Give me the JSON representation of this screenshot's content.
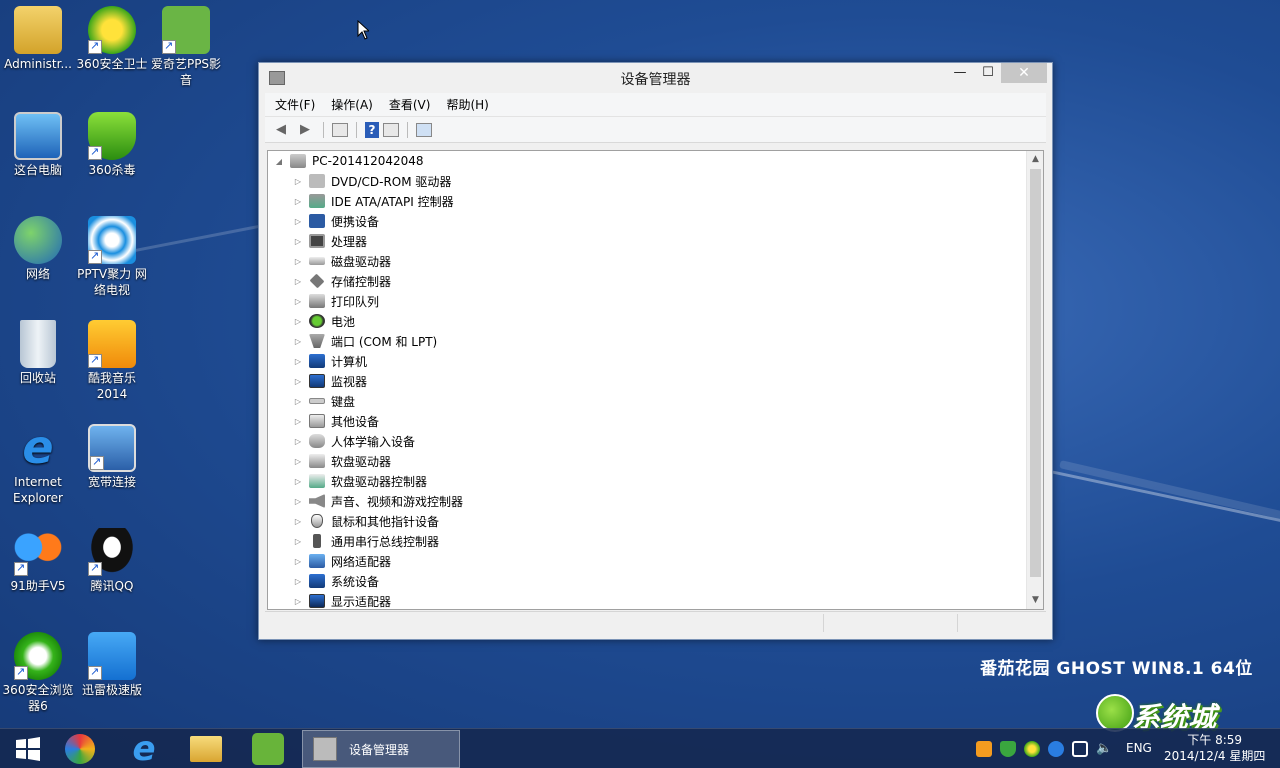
{
  "desktop_icons": [
    {
      "label": "Administr..."
    },
    {
      "label": "360安全卫士"
    },
    {
      "label": "爱奇艺PPS影音"
    },
    {
      "label": "这台电脑"
    },
    {
      "label": "360杀毒"
    },
    {
      "label": "网络"
    },
    {
      "label": "PPTV聚力 网络电视"
    },
    {
      "label": "回收站"
    },
    {
      "label": "酷我音乐2014"
    },
    {
      "label": "Internet Explorer"
    },
    {
      "label": "宽带连接"
    },
    {
      "label": "91助手V5"
    },
    {
      "label": "腾讯QQ"
    },
    {
      "label": "360安全浏览器6"
    },
    {
      "label": "迅雷极速版"
    }
  ],
  "window": {
    "title": "设备管理器",
    "controls": {
      "minimize": "—",
      "maximize": "☐",
      "close": "✕"
    },
    "menu": [
      "文件(F)",
      "操作(A)",
      "查看(V)",
      "帮助(H)"
    ],
    "tree": {
      "root": "PC-201412042048",
      "items": [
        "DVD/CD-ROM 驱动器",
        "IDE ATA/ATAPI 控制器",
        "便携设备",
        "处理器",
        "磁盘驱动器",
        "存储控制器",
        "打印队列",
        "电池",
        "端口 (COM 和 LPT)",
        "计算机",
        "监视器",
        "键盘",
        "其他设备",
        "人体学输入设备",
        "软盘驱动器",
        "软盘驱动器控制器",
        "声音、视频和游戏控制器",
        "鼠标和其他指针设备",
        "通用串行总线控制器",
        "网络适配器",
        "系统设备",
        "显示适配器"
      ]
    }
  },
  "watermark": {
    "brand": "番茄花园 GHOST WIN8.1 64位",
    "logo_text": "系统城"
  },
  "taskbar": {
    "active_window": "设备管理器",
    "language": "ENG",
    "time": "下午 8:59",
    "date": "2014/12/4 星期四"
  },
  "colors": {
    "desktop": "#1f4c94",
    "accent": "#2a5db8"
  }
}
